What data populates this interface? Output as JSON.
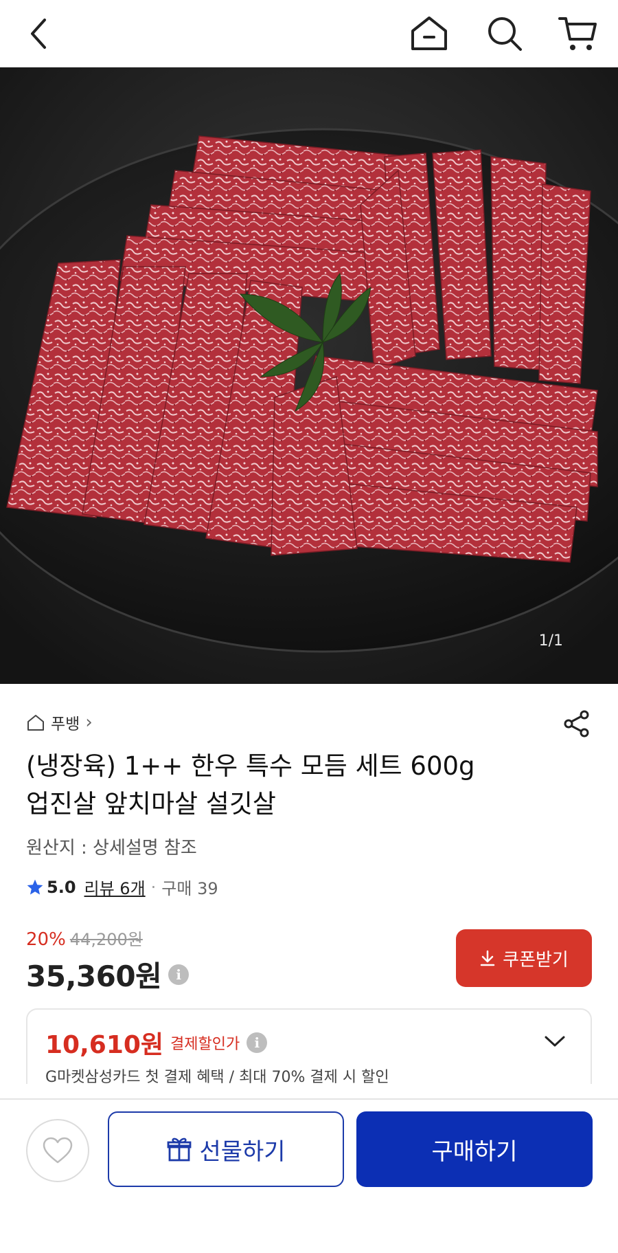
{
  "header": {
    "icons": [
      "back-icon",
      "home-icon",
      "search-icon",
      "cart-icon"
    ]
  },
  "gallery": {
    "pager": "1/1"
  },
  "product": {
    "seller": "푸뱅",
    "seller_chevron": "›",
    "title_line1": "(냉장육) 1++ 한우 특수 모듬 세트 600g",
    "title_line2": "업진살 앞치마살 설깃살",
    "origin": "원산지 : 상세설명 참조",
    "rating": "5.0",
    "review": "리뷰 6개",
    "dot": "·",
    "sales": "구매 39",
    "discount_rate": "20%",
    "original_price": "44,200원",
    "price": "35,360원",
    "info_mark": "i",
    "coupon_label": "쿠폰받기"
  },
  "card_offer": {
    "price": "10,610원",
    "tag": "결제할인가",
    "info_mark": "i",
    "description": "G마켓삼성카드 첫 결제 혜택 / 최대 70% 결제 시 할인"
  },
  "bottom": {
    "gift_label": "선물하기",
    "buy_label": "구매하기"
  },
  "colors": {
    "accent_blue": "#0c2fb4",
    "discount_red": "#d62d20",
    "coupon_red": "#d6362a"
  }
}
